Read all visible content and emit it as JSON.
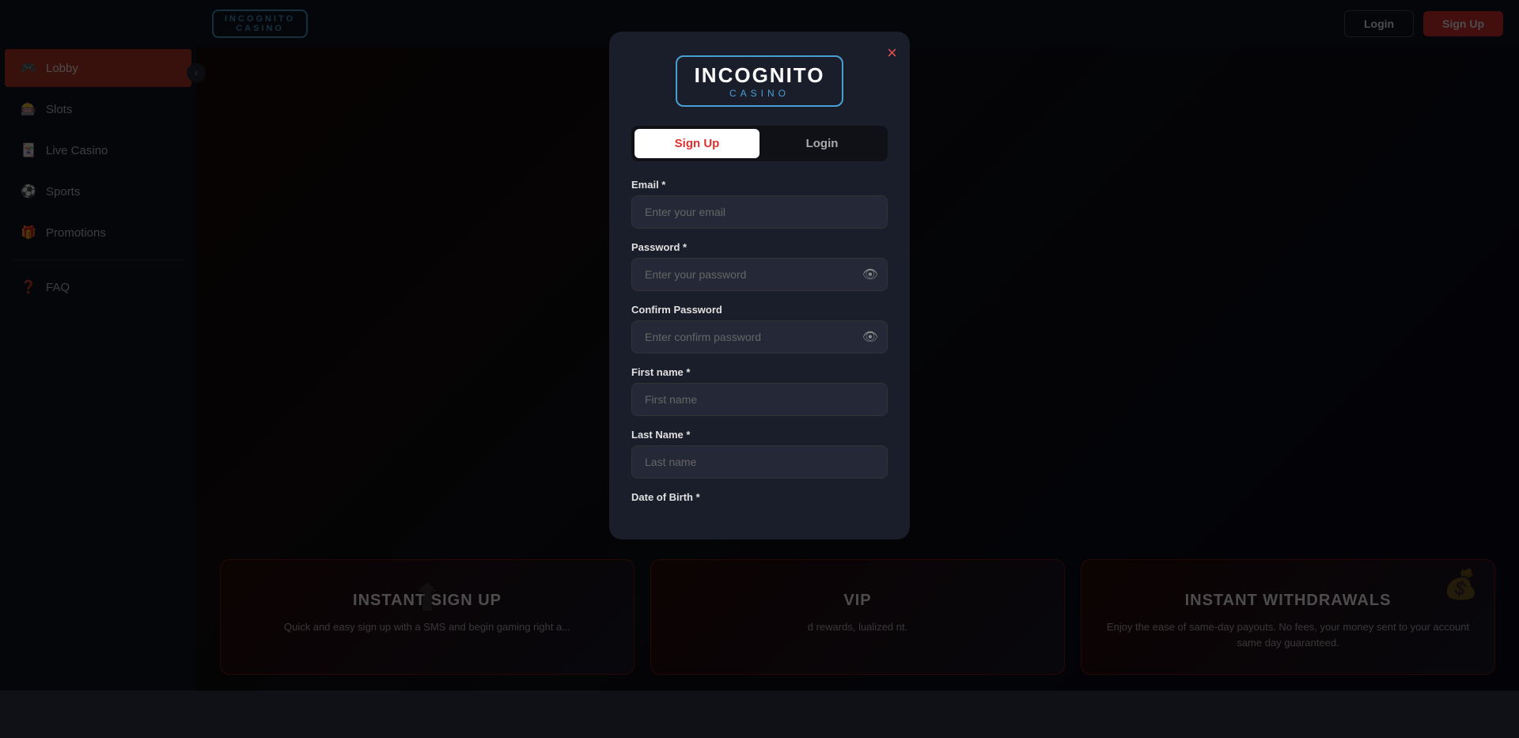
{
  "brand": {
    "name": "INCOGNITO",
    "sub": "CASINO"
  },
  "topnav": {
    "login_label": "Login",
    "signup_label": "Sign Up"
  },
  "sidebar": {
    "items": [
      {
        "id": "lobby",
        "label": "Lobby",
        "icon": "🎮",
        "active": true
      },
      {
        "id": "slots",
        "label": "Slots",
        "icon": "🎰",
        "active": false
      },
      {
        "id": "live-casino",
        "label": "Live Casino",
        "icon": "🃏",
        "active": false
      },
      {
        "id": "sports",
        "label": "Sports",
        "icon": "⚽",
        "active": false
      },
      {
        "id": "promotions",
        "label": "Promotions",
        "icon": "🎁",
        "active": false
      }
    ],
    "divider": true,
    "items2": [
      {
        "id": "faq",
        "label": "FAQ",
        "icon": "❓",
        "active": false
      }
    ]
  },
  "modal": {
    "close_label": "×",
    "tabs": [
      {
        "id": "signup",
        "label": "Sign Up",
        "active": true
      },
      {
        "id": "login",
        "label": "Login",
        "active": false
      }
    ],
    "form": {
      "email_label": "Email *",
      "email_placeholder": "Enter your email",
      "password_label": "Password *",
      "password_placeholder": "Enter your password",
      "confirm_password_label": "Confirm Password",
      "confirm_password_placeholder": "Enter confirm password",
      "first_name_label": "First name *",
      "first_name_placeholder": "First name",
      "last_name_label": "Last Name *",
      "last_name_placeholder": "Last name",
      "dob_label": "Date of Birth *"
    }
  },
  "promo_cards": [
    {
      "id": "instant-signup",
      "title": "INSTANT SIGN UP",
      "text": "Quick and easy sign up with a SMS and begin gaming right a...",
      "icon": "cursor"
    },
    {
      "id": "vip",
      "title": "VIP",
      "text": "d rewards, lualized nt.",
      "icon": ""
    },
    {
      "id": "instant-withdrawals",
      "title": "INSTANT WITHDRAWALS",
      "text": "Enjoy the ease of same-day payouts. No fees, your money sent to your account same day guaranteed.",
      "icon": "money"
    }
  ]
}
